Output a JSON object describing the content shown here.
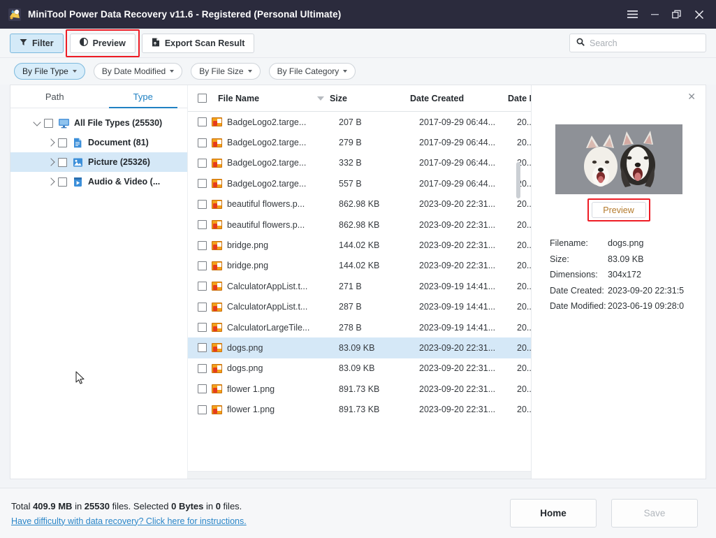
{
  "window": {
    "title": "MiniTool Power Data Recovery v11.6 - Registered (Personal Ultimate)",
    "controls": {
      "menu": "☰",
      "minimize": "–",
      "restore": "❐",
      "close": "✕"
    }
  },
  "toolbar": {
    "filter_label": "Filter",
    "preview_label": "Preview",
    "export_label": "Export Scan Result",
    "search_placeholder": "Search",
    "search_value": ""
  },
  "filters": [
    {
      "label": "By File Type",
      "active": true
    },
    {
      "label": "By Date Modified",
      "active": false
    },
    {
      "label": "By File Size",
      "active": false
    },
    {
      "label": "By File Category",
      "active": false
    }
  ],
  "sidebar": {
    "tabs": [
      {
        "label": "Path",
        "active": false
      },
      {
        "label": "Type",
        "active": true
      }
    ],
    "tree": [
      {
        "label": "All File Types (25530)",
        "depth": 0,
        "expanded": true,
        "selected": false,
        "icon": "monitor-icon"
      },
      {
        "label": "Document (81)",
        "depth": 1,
        "expanded": false,
        "selected": false,
        "icon": "document-icon"
      },
      {
        "label": "Picture (25326)",
        "depth": 1,
        "expanded": false,
        "selected": true,
        "icon": "picture-icon"
      },
      {
        "label": "Audio & Video (...",
        "depth": 1,
        "expanded": false,
        "selected": false,
        "icon": "media-icon"
      }
    ]
  },
  "file_list": {
    "columns": [
      "File Name",
      "Size",
      "Date Created",
      "Date M"
    ],
    "rows": [
      {
        "name": "BadgeLogo2.targe...",
        "size": "207 B",
        "created": "2017-09-29 06:44...",
        "modified": "20...",
        "selected": false
      },
      {
        "name": "BadgeLogo2.targe...",
        "size": "279 B",
        "created": "2017-09-29 06:44...",
        "modified": "20...",
        "selected": false
      },
      {
        "name": "BadgeLogo2.targe...",
        "size": "332 B",
        "created": "2017-09-29 06:44...",
        "modified": "20...",
        "selected": false
      },
      {
        "name": "BadgeLogo2.targe...",
        "size": "557 B",
        "created": "2017-09-29 06:44...",
        "modified": "20...",
        "selected": false
      },
      {
        "name": "beautiful flowers.p...",
        "size": "862.98 KB",
        "created": "2023-09-20 22:31...",
        "modified": "20...",
        "selected": false
      },
      {
        "name": "beautiful flowers.p...",
        "size": "862.98 KB",
        "created": "2023-09-20 22:31...",
        "modified": "20...",
        "selected": false
      },
      {
        "name": "bridge.png",
        "size": "144.02 KB",
        "created": "2023-09-20 22:31...",
        "modified": "20...",
        "selected": false
      },
      {
        "name": "bridge.png",
        "size": "144.02 KB",
        "created": "2023-09-20 22:31...",
        "modified": "20...",
        "selected": false
      },
      {
        "name": "CalculatorAppList.t...",
        "size": "271 B",
        "created": "2023-09-19 14:41...",
        "modified": "20...",
        "selected": false
      },
      {
        "name": "CalculatorAppList.t...",
        "size": "287 B",
        "created": "2023-09-19 14:41...",
        "modified": "20...",
        "selected": false
      },
      {
        "name": "CalculatorLargeTile...",
        "size": "278 B",
        "created": "2023-09-19 14:41...",
        "modified": "20...",
        "selected": false
      },
      {
        "name": "dogs.png",
        "size": "83.09 KB",
        "created": "2023-09-20 22:31...",
        "modified": "20...",
        "selected": true
      },
      {
        "name": "dogs.png",
        "size": "83.09 KB",
        "created": "2023-09-20 22:31...",
        "modified": "20...",
        "selected": false
      },
      {
        "name": "flower 1.png",
        "size": "891.73 KB",
        "created": "2023-09-20 22:31...",
        "modified": "20...",
        "selected": false
      },
      {
        "name": "flower 1.png",
        "size": "891.73 KB",
        "created": "2023-09-20 22:31...",
        "modified": "20...",
        "selected": false
      }
    ]
  },
  "preview": {
    "close_label": "✕",
    "button_label": "Preview",
    "meta": [
      {
        "key": "Filename:",
        "value": "dogs.png"
      },
      {
        "key": "Size:",
        "value": "83.09 KB"
      },
      {
        "key": "Dimensions:",
        "value": "304x172"
      },
      {
        "key": "Date Created:",
        "value": "2023-09-20 22:31:5"
      },
      {
        "key": "Date Modified:",
        "value": "2023-06-19 09:28:0"
      }
    ]
  },
  "footer": {
    "total_prefix": "Total ",
    "total_size": "409.9 MB",
    "total_mid": " in ",
    "total_count": "25530",
    "total_suffix": " files.  Selected ",
    "selected_size": "0 Bytes",
    "selected_mid": " in ",
    "selected_count": "0",
    "selected_suffix": " files.",
    "help_link": "Have difficulty with data recovery? Click here for instructions.",
    "home_label": "Home",
    "save_label": "Save"
  },
  "colors": {
    "titlebar": "#2b2b3d",
    "accent": "#2081c3",
    "highlight": "#d5e8f7",
    "redbox": "#ee1c25",
    "link": "#2a86c8"
  }
}
